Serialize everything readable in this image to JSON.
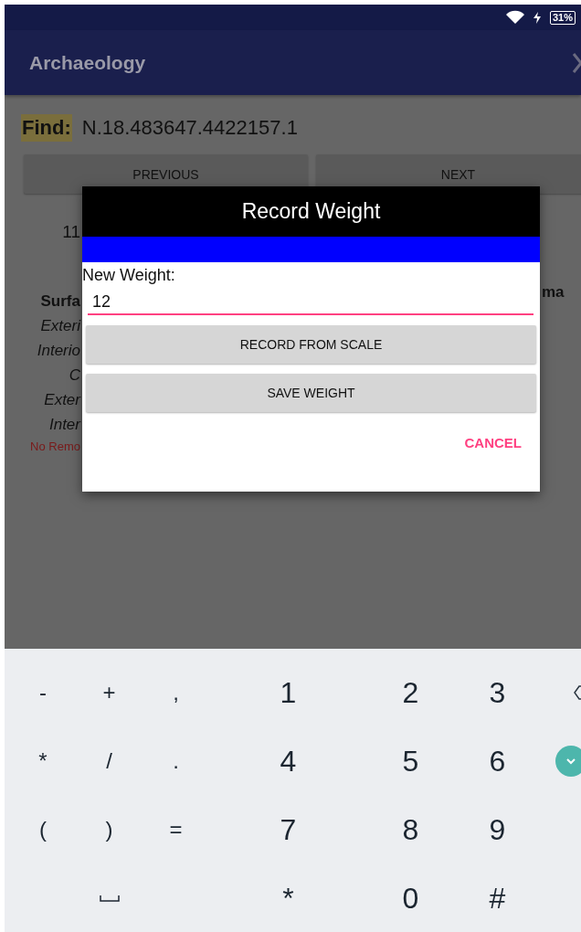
{
  "status_bar": {
    "battery": "31%"
  },
  "app_bar": {
    "title": "Archaeology"
  },
  "find": {
    "label": "Find:",
    "value": "N.18.483647.4422157.1"
  },
  "nav_buttons": [
    "PREVIOUS",
    "NEXT"
  ],
  "behind_dialog": {
    "number": "11",
    "heading": "Surfa",
    "right_heading": "ma",
    "rows": [
      {
        "text": "Exteri"
      },
      {
        "text": "Interio"
      },
      {
        "text": "C"
      },
      {
        "text": "Exter"
      },
      {
        "text": "Inter"
      }
    ],
    "warning": "No Remo"
  },
  "dialog": {
    "title": "Record Weight",
    "field_label": "New Weight:",
    "value": "12",
    "buttons": [
      "RECORD FROM SCALE",
      "SAVE WEIGHT"
    ],
    "cancel": "CANCEL"
  },
  "keyboard": {
    "rows": [
      [
        {
          "kind": "symbol",
          "label": "-"
        },
        {
          "kind": "symbol",
          "label": "+"
        },
        {
          "kind": "symbol",
          "label": ","
        },
        {
          "kind": "digit",
          "label": "1"
        },
        {
          "kind": "digit",
          "label": "2"
        },
        {
          "kind": "digit",
          "label": "3"
        },
        {
          "kind": "backspace"
        }
      ],
      [
        {
          "kind": "symbol",
          "label": "*"
        },
        {
          "kind": "symbol",
          "label": "/"
        },
        {
          "kind": "symbol",
          "label": "."
        },
        {
          "kind": "digit",
          "label": "4"
        },
        {
          "kind": "digit",
          "label": "5"
        },
        {
          "kind": "digit",
          "label": "6"
        },
        {
          "kind": "done"
        }
      ],
      [
        {
          "kind": "symbol",
          "label": "("
        },
        {
          "kind": "symbol",
          "label": ")"
        },
        {
          "kind": "symbol",
          "label": "="
        },
        {
          "kind": "digit",
          "label": "7"
        },
        {
          "kind": "digit",
          "label": "8"
        },
        {
          "kind": "digit",
          "label": "9"
        },
        {
          "kind": "blank"
        }
      ],
      [
        {
          "kind": "blank"
        },
        {
          "kind": "space"
        },
        {
          "kind": "blank"
        },
        {
          "kind": "digit",
          "label": "*"
        },
        {
          "kind": "digit",
          "label": "0"
        },
        {
          "kind": "digit",
          "label": "#"
        },
        {
          "kind": "blank"
        }
      ]
    ]
  }
}
